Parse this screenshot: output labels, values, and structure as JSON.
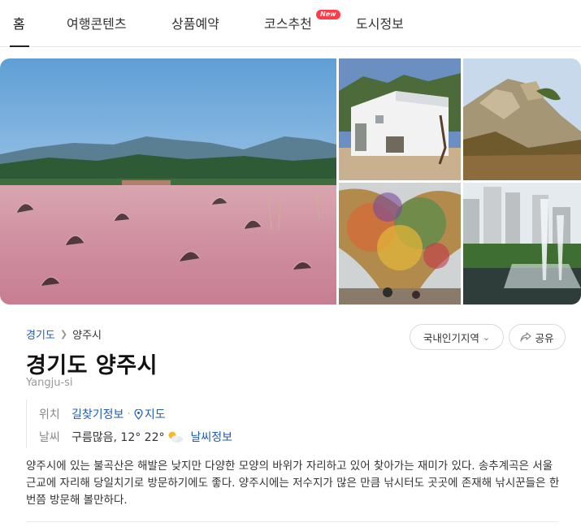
{
  "tabs": [
    {
      "label": "홈"
    },
    {
      "label": "여행콘텐츠"
    },
    {
      "label": "상품예약"
    },
    {
      "label": "코스추천"
    },
    {
      "label": "도시정보"
    }
  ],
  "new_badge": "New",
  "breadcrumb": {
    "parent": "경기도",
    "current": "양주시"
  },
  "actions": {
    "region_label": "국내인기지역",
    "share_label": "공유"
  },
  "title": "경기도 양주시",
  "subtitle": "Yangju-si",
  "info": {
    "location_label": "위치",
    "directions_link": "길찾기정보",
    "map_link": "지도",
    "weather_label": "날씨",
    "weather_text": "구름많음, 12° 22°",
    "weather_link": "날씨정보"
  },
  "description": "양주시에 있는 불곡산은 해발은 낮지만 다양한 모양의 바위가 자리하고 있어 찾아가는 재미가 있다. 송추계곡은 서울 근교에 자리해 당일치기로 방문하기에도 좋다. 양주시에는 저수지가 많은 만큼 낚시터도 곳곳에 존재해 낚시꾼들은 한 번쯤 방문해 볼만하다.",
  "colors": {
    "link": "#1e5bb8",
    "badge": "#ff3b4a",
    "active_tab": "#222222"
  },
  "icons": [
    "chevron-right-icon",
    "chevron-down-icon",
    "share-icon",
    "map-pin-icon",
    "partly-cloudy-icon"
  ]
}
